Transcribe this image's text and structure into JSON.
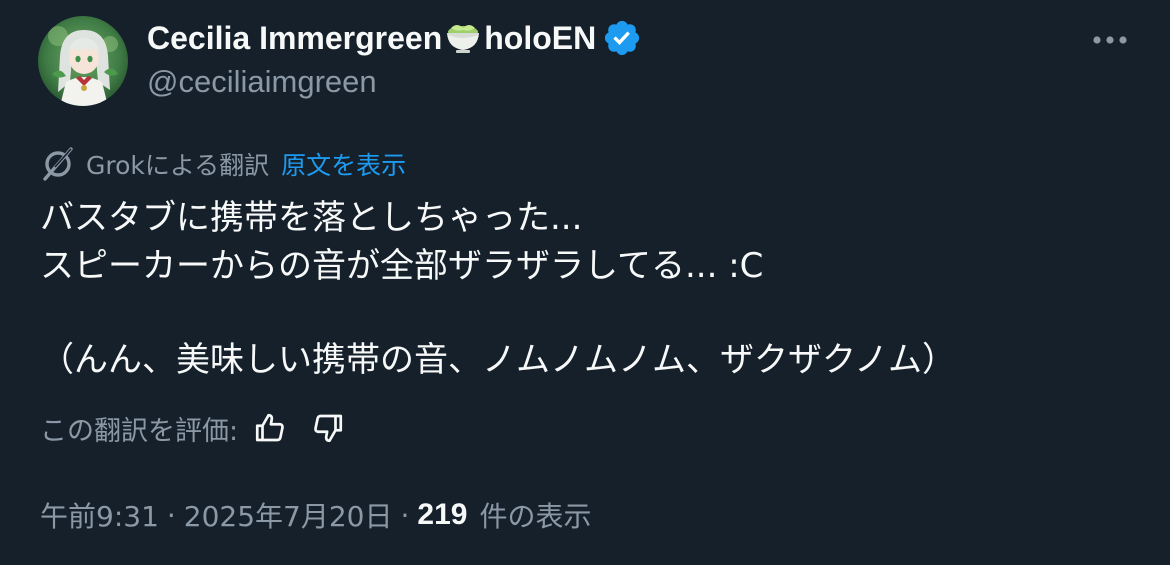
{
  "author": {
    "display_name_part1": "Cecilia Immergreen",
    "display_name_part2": "holoEN",
    "handle": "@ceciliaimgreen",
    "name_emoji": "tea-cup-icon",
    "verified_badge": "verified-badge-icon"
  },
  "colors": {
    "background": "#15202b",
    "primary_text": "#f7f9f9",
    "secondary_text": "#8b98a5",
    "accent": "#1d9bf0"
  },
  "translation": {
    "label": "Grokによる翻訳",
    "show_original": "原文を表示",
    "icon": "grok-icon"
  },
  "body": {
    "line1": "バスタブに携帯を落としちゃった...",
    "line2": "スピーカーからの音が全部ザラザラしてる... :C",
    "line3": "（んん、美味しい携帯の音、ノムノムノム、ザクザクノム）"
  },
  "rating": {
    "label": "この翻訳を評価:",
    "thumbs_up_icon": "thumbs-up-icon",
    "thumbs_down_icon": "thumbs-down-icon"
  },
  "meta": {
    "time": "午前9:31",
    "separator": "·",
    "date": "2025年7月20日",
    "views_count": "219",
    "views_label": "件の表示"
  },
  "menu": {
    "more_icon": "more-horizontal-icon"
  }
}
